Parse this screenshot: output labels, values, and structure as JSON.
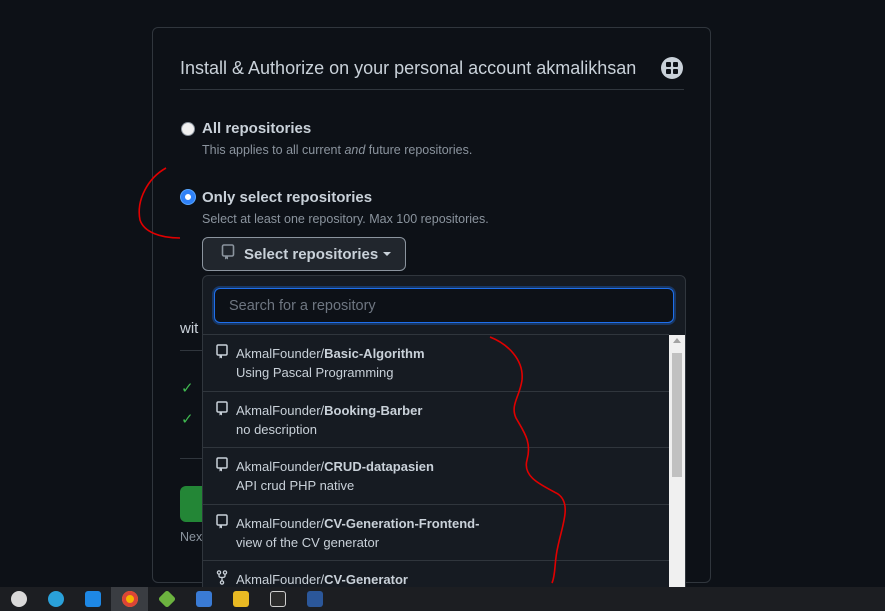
{
  "card": {
    "title": "Install & Authorize on your personal account akmalikhsan",
    "avatar_icon": "app-logo-icon"
  },
  "options": {
    "all": {
      "label": "All repositories",
      "desc_before": "This applies to all current ",
      "desc_em": "and",
      "desc_after": " future repositories.",
      "selected": false
    },
    "select": {
      "label": "Only select repositories",
      "desc": "Select at least one repository. Max 100 repositories.",
      "selected": true
    }
  },
  "select_button": {
    "label": "Select repositories",
    "icon": "repo-icon"
  },
  "behind": {
    "with_text": "wit",
    "next_text": "Nex"
  },
  "dropdown": {
    "search_placeholder": "Search for a repository",
    "items": [
      {
        "owner": "AkmalFounder/",
        "repo": "Basic-Algorithm",
        "desc": "Using Pascal Programming",
        "icon": "repo-icon"
      },
      {
        "owner": "AkmalFounder/",
        "repo": "Booking-Barber",
        "desc": "no description",
        "icon": "repo-icon"
      },
      {
        "owner": "AkmalFounder/",
        "repo": "CRUD-datapasien",
        "desc": "API crud PHP native",
        "icon": "repo-icon"
      },
      {
        "owner": "AkmalFounder/",
        "repo": "CV-Generation-Frontend-",
        "desc": "view of the CV generator",
        "icon": "repo-icon"
      },
      {
        "owner": "AkmalFounder/",
        "repo": "CV-Generator",
        "desc": "",
        "icon": "repo-forked-icon"
      }
    ]
  },
  "colors": {
    "accent": "#2f81f7",
    "background": "#0d1117",
    "border": "#30363d",
    "success": "#3fb950",
    "annotation": "#e00000"
  },
  "taskbar": {
    "apps": [
      "app-icon",
      "telegram-icon",
      "vscode-icon",
      "chrome-icon",
      "git-icon",
      "photos-icon",
      "filezilla-icon",
      "terminal-icon",
      "word-icon"
    ]
  }
}
